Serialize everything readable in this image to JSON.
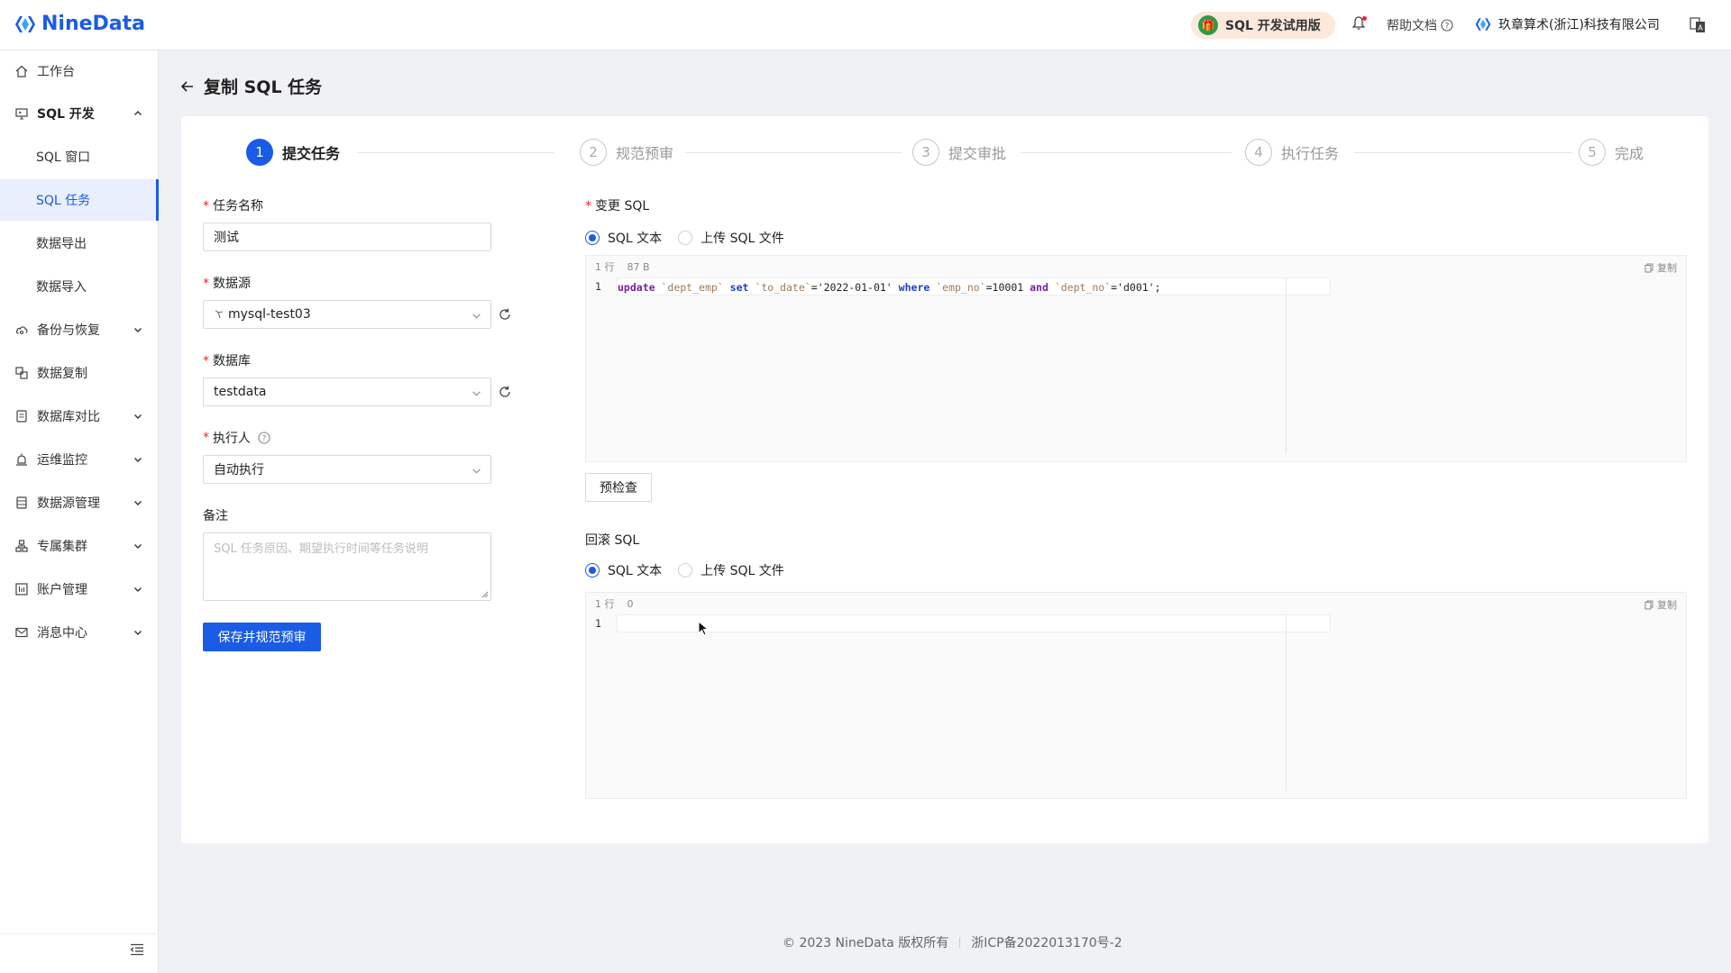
{
  "app": {
    "name": "NineData"
  },
  "header": {
    "trial_badge": "SQL 开发试用版",
    "help_label": "帮助文档",
    "org_name": "玖章算术(浙江)科技有限公司"
  },
  "sidebar": {
    "items": [
      {
        "label": "工作台",
        "icon": "home-icon",
        "expandable": false
      },
      {
        "label": "SQL 开发",
        "icon": "monitor-icon",
        "expandable": true,
        "expanded": true
      },
      {
        "label": "SQL 窗口",
        "sub": true
      },
      {
        "label": "SQL 任务",
        "sub": true,
        "active": true
      },
      {
        "label": "数据导出",
        "sub": true
      },
      {
        "label": "数据导入",
        "sub": true
      },
      {
        "label": "备份与恢复",
        "icon": "cloud-icon",
        "expandable": true
      },
      {
        "label": "数据复制",
        "icon": "copy-icon",
        "expandable": false
      },
      {
        "label": "数据库对比",
        "icon": "compare-icon",
        "expandable": true
      },
      {
        "label": "运维监控",
        "icon": "alarm-icon",
        "expandable": true
      },
      {
        "label": "数据源管理",
        "icon": "database-icon",
        "expandable": true
      },
      {
        "label": "专属集群",
        "icon": "cluster-icon",
        "expandable": true
      },
      {
        "label": "账户管理",
        "icon": "account-icon",
        "expandable": true
      },
      {
        "label": "消息中心",
        "icon": "mail-icon",
        "expandable": true
      }
    ]
  },
  "page": {
    "title": "复制 SQL 任务"
  },
  "steps": [
    {
      "num": "1",
      "label": "提交任务",
      "active": true
    },
    {
      "num": "2",
      "label": "规范预审"
    },
    {
      "num": "3",
      "label": "提交审批"
    },
    {
      "num": "4",
      "label": "执行任务"
    },
    {
      "num": "5",
      "label": "完成"
    }
  ],
  "form": {
    "task_name_label": "任务名称",
    "task_name_value": "测试",
    "datasource_label": "数据源",
    "datasource_value": "mysql-test03",
    "database_label": "数据库",
    "database_value": "testdata",
    "executor_label": "执行人",
    "executor_value": "自动执行",
    "remark_label": "备注",
    "remark_placeholder": "SQL 任务原因、期望执行时间等任务说明",
    "save_button": "保存并规范预审"
  },
  "change_sql": {
    "label": "变更 SQL",
    "option_text": "SQL 文本",
    "option_file": "上传 SQL 文件",
    "meta_lines": "1 行",
    "meta_size": "87 B",
    "copy_label": "复制",
    "line_no": "1",
    "code_tokens": [
      {
        "t": "update",
        "c": "kw"
      },
      {
        "t": " ",
        "c": ""
      },
      {
        "t": "`dept_emp`",
        "c": "id"
      },
      {
        "t": " ",
        "c": ""
      },
      {
        "t": "set",
        "c": "kw2"
      },
      {
        "t": " ",
        "c": ""
      },
      {
        "t": "`to_date`",
        "c": "id"
      },
      {
        "t": "=",
        "c": ""
      },
      {
        "t": "'2022-01-01'",
        "c": "str"
      },
      {
        "t": " ",
        "c": ""
      },
      {
        "t": "where",
        "c": "kw2"
      },
      {
        "t": " ",
        "c": ""
      },
      {
        "t": "`emp_no`",
        "c": "id"
      },
      {
        "t": "=10001 ",
        "c": "num"
      },
      {
        "t": "and",
        "c": "kw"
      },
      {
        "t": " ",
        "c": ""
      },
      {
        "t": "`dept_no`",
        "c": "id"
      },
      {
        "t": "='d001';",
        "c": "str"
      }
    ],
    "precheck_button": "预检查"
  },
  "rollback_sql": {
    "label": "回滚 SQL",
    "option_text": "SQL 文本",
    "option_file": "上传 SQL 文件",
    "meta_lines": "1 行",
    "meta_size": "0",
    "copy_label": "复制",
    "line_no": "1"
  },
  "footer": {
    "copyright": "© 2023 NineData 版权所有",
    "icp": "浙ICP备2022013170号-2"
  },
  "colors": {
    "primary": "#1a5ce6",
    "required": "#f5222d"
  }
}
